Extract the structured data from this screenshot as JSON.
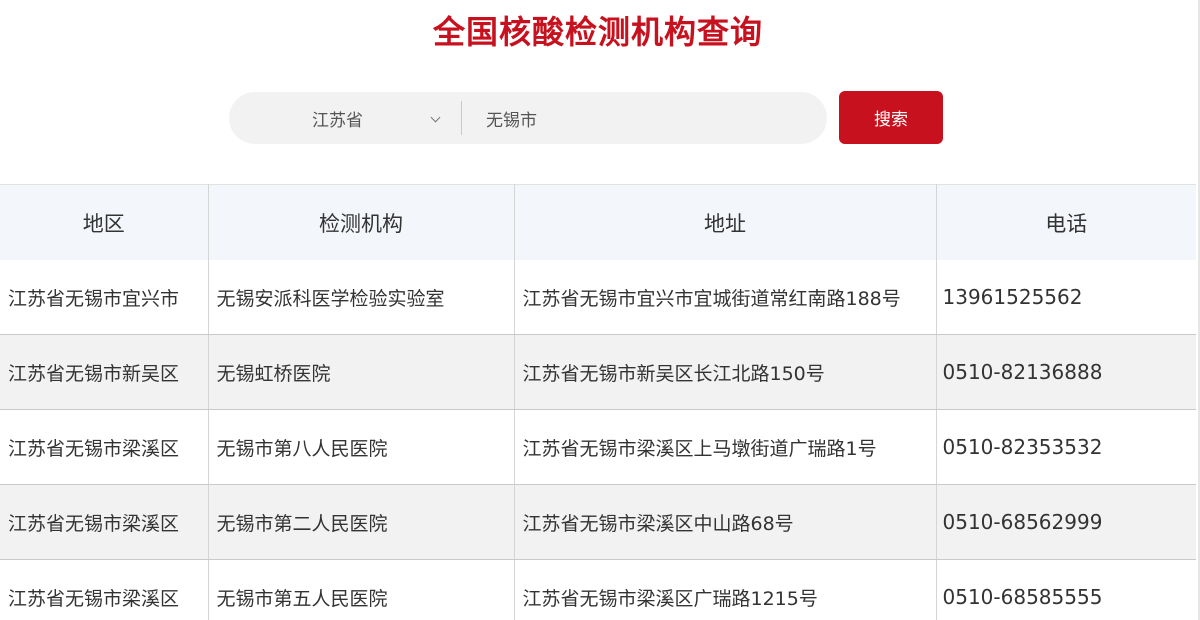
{
  "title": "全国核酸检测机构查询",
  "search": {
    "province": "江苏省",
    "city": "无锡市",
    "button_label": "搜索"
  },
  "table": {
    "headers": [
      "地区",
      "检测机构",
      "地址",
      "电话"
    ],
    "rows": [
      {
        "region": "江苏省无锡市宜兴市",
        "institution": "无锡安派科医学检验实验室",
        "address": "江苏省无锡市宜兴市宜城街道常红南路188号",
        "phone": "13961525562"
      },
      {
        "region": "江苏省无锡市新吴区",
        "institution": "无锡虹桥医院",
        "address": "江苏省无锡市新吴区长江北路150号",
        "phone": "0510-82136888"
      },
      {
        "region": "江苏省无锡市梁溪区",
        "institution": "无锡市第八人民医院",
        "address": "江苏省无锡市梁溪区上马墩街道广瑞路1号",
        "phone": "0510-82353532"
      },
      {
        "region": "江苏省无锡市梁溪区",
        "institution": "无锡市第二人民医院",
        "address": "江苏省无锡市梁溪区中山路68号",
        "phone": "0510-68562999"
      },
      {
        "region": "江苏省无锡市梁溪区",
        "institution": "无锡市第五人民医院",
        "address": "江苏省无锡市梁溪区广瑞路1215号",
        "phone": "0510-68585555"
      }
    ]
  },
  "colors": {
    "accent": "#c8111e",
    "header_bg": "#f3f6fa",
    "alt_row_bg": "#f2f2f2"
  }
}
